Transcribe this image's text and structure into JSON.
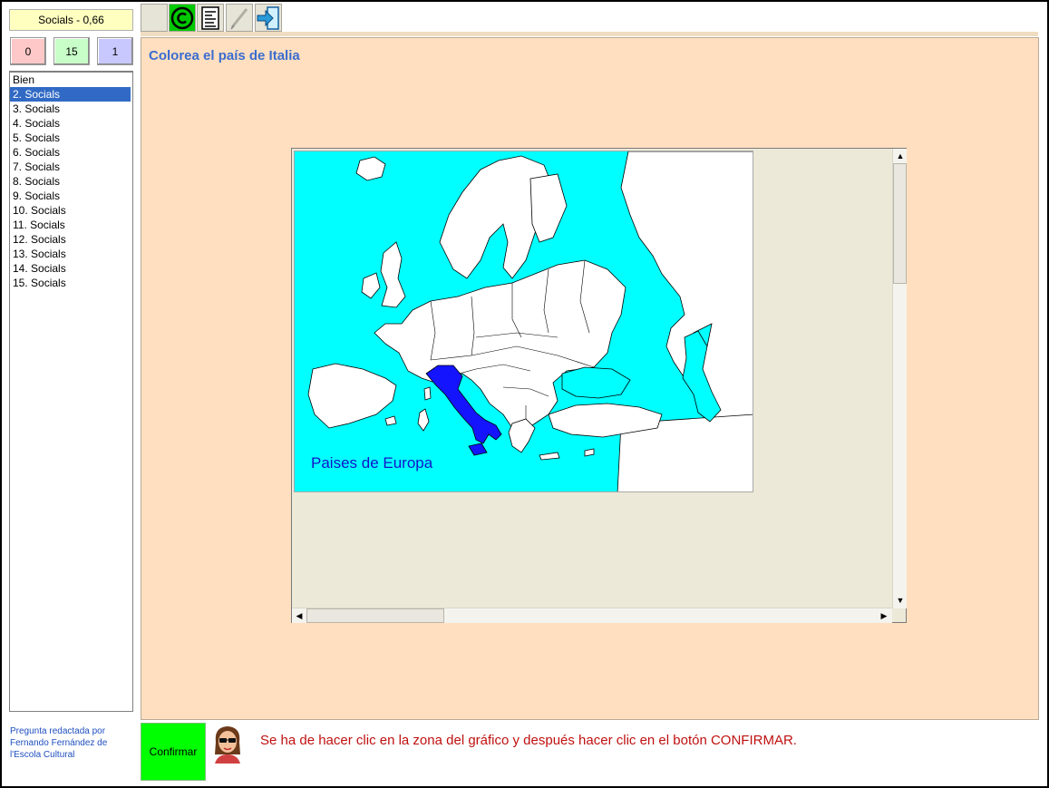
{
  "header": {
    "title": "Socials -  0,66"
  },
  "scores": {
    "wrong": "0",
    "total": "15",
    "right": "1"
  },
  "question_list": {
    "items": [
      "Bien",
      "2. Socials",
      "3. Socials",
      "4. Socials",
      "5. Socials",
      "6. Socials",
      "7. Socials",
      "8. Socials",
      "9. Socials",
      "10. Socials",
      "11. Socials",
      "12. Socials",
      "13. Socials",
      "14. Socials",
      "15. Socials"
    ],
    "selected_index": 1
  },
  "credits": {
    "text": "Pregunta redactada por Fernando Fernández de l'Escola Cultural"
  },
  "toolbar": {
    "buttons": [
      "blank-button",
      "copyright-icon",
      "document-icon",
      "pen-icon",
      "exit-icon"
    ]
  },
  "main": {
    "question": "Colorea el país de Italia",
    "map_label": "Paises de Europa"
  },
  "footer": {
    "confirm_label": "Confirmar",
    "instructions": "Se ha de hacer clic en la zona del gráfico y después hacer clic en el botón CONFIRMAR."
  },
  "colors": {
    "sea": "#00ffff",
    "land": "#ffffff",
    "highlight": "#1414ff",
    "main_bg": "#ffdfc0",
    "confirm": "#00ff00"
  }
}
